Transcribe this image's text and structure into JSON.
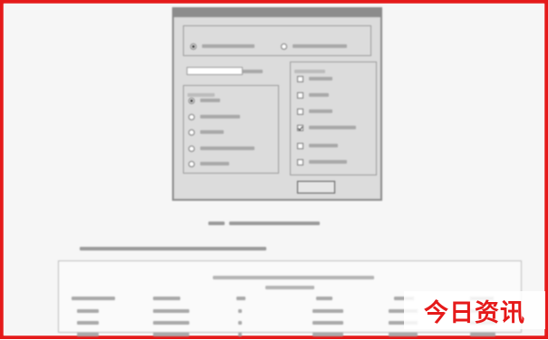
{
  "page": {
    "frame_color": "#e51a1a"
  },
  "dialog": {
    "title": "",
    "top_group": {
      "label": "",
      "options": [
        {
          "label": "",
          "selected": true
        },
        {
          "label": "",
          "selected": false
        }
      ]
    },
    "input": {
      "label": "",
      "value": ""
    },
    "left_group": {
      "label": "",
      "options": [
        {
          "label": "",
          "selected": true
        },
        {
          "label": "",
          "selected": false
        },
        {
          "label": "",
          "selected": false
        },
        {
          "label": "",
          "selected": false
        },
        {
          "label": "",
          "selected": false
        }
      ]
    },
    "right_group": {
      "label": "",
      "checkboxes": [
        {
          "label": "",
          "checked": false
        },
        {
          "label": "",
          "checked": false
        },
        {
          "label": "",
          "checked": false
        },
        {
          "label": "",
          "checked": true
        },
        {
          "label": "",
          "checked": false
        },
        {
          "label": "",
          "checked": false
        }
      ]
    },
    "ok_button": ""
  },
  "figure_caption": "",
  "paragraph": "",
  "table": {
    "title": "",
    "subtitle": "",
    "header": [
      "",
      "",
      "",
      "",
      "",
      ""
    ],
    "rows": [
      [
        "",
        "",
        "",
        "",
        "",
        ""
      ],
      [
        "",
        "",
        "",
        "",
        "",
        ""
      ],
      [
        "",
        "",
        "",
        "",
        "",
        ""
      ]
    ]
  },
  "watermark": {
    "text": "今日资讯",
    "color": "#e51a1a"
  }
}
